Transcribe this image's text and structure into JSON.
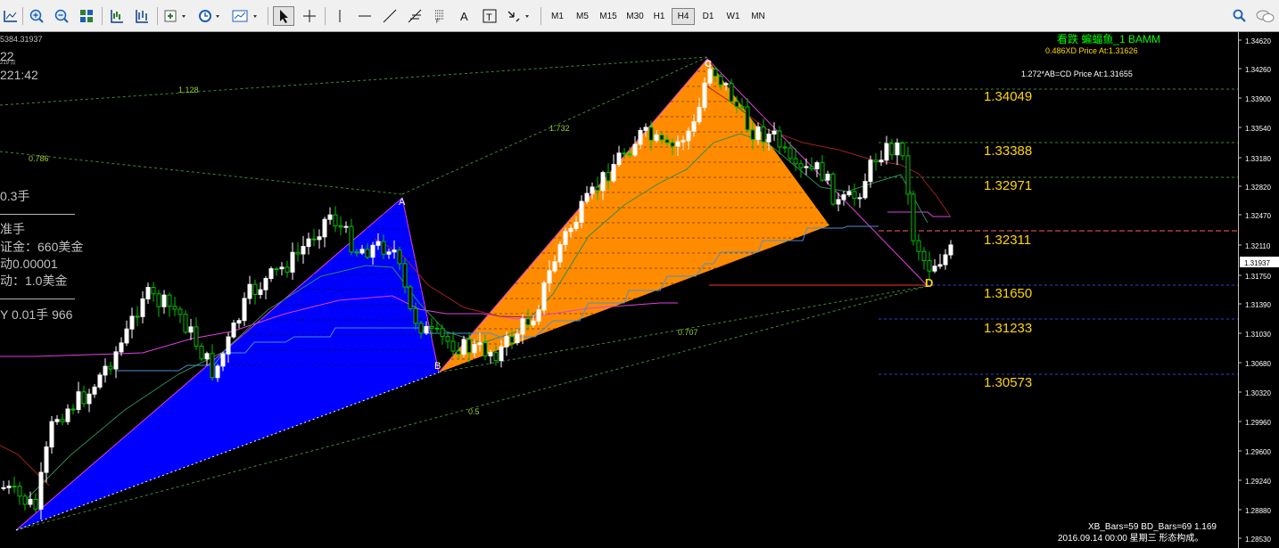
{
  "toolbar": {
    "timeframes": [
      "M1",
      "M5",
      "M15",
      "M30",
      "H1",
      "H4",
      "D1",
      "W1",
      "MN"
    ],
    "active_timeframe": "H4",
    "icons": [
      "chart-props-icon",
      "zoom-in-icon",
      "zoom-out-icon",
      "tile-windows-icon",
      "autoscroll-icon",
      "chart-shift-icon",
      "indicators-icon",
      "period-clock-icon",
      "templates-icon",
      "cursor-icon",
      "crosshair-icon",
      "vertical-line-icon",
      "horizontal-line-icon",
      "trendline-icon",
      "fibonacci-icon",
      "text-icon",
      "text-label-icon",
      "arrows-icon",
      "search-icon",
      "chat-icon"
    ]
  },
  "top_left": {
    "symbol_line": "5384.31937",
    "line2": "22",
    "line3": "219 点",
    "line4": "221:42"
  },
  "info_panel": {
    "lot": "0.3手",
    "dashes1": "——————",
    "standard": "准手",
    "margin": "证金：660美金",
    "move": "动0.00001",
    "move_value": "动：1.0美金",
    "dashes2": "——————",
    "buy": "Y  0.01手  966"
  },
  "pattern": {
    "title": "看跌 蝙蝠鱼_1 BAMM",
    "xd_text": "0.486XD Price At:1.31626",
    "abcd_text": "1.272*AB=CD Price At:1.31655",
    "points": [
      "A",
      "B",
      "C",
      "D"
    ],
    "footer_bars": "XB_Bars=59 BD_Bars=69 1.169",
    "footer_time": "2016.09.14 00:00 星期三 形态构成。"
  },
  "fib_ratios": [
    "1.128",
    "0.786",
    "1.732",
    "0.707",
    "0.5"
  ],
  "levels": [
    "1.34049",
    "1.33388",
    "1.32971",
    "1.32311",
    "1.31650",
    "1.31233",
    "1.30573"
  ],
  "current_price": "1.31937",
  "price_axis": [
    "1.34620",
    "1.34260",
    "1.33900",
    "1.33540",
    "1.33180",
    "1.32820",
    "1.32470",
    "1.32110",
    "1.31750",
    "1.31390",
    "1.31030",
    "1.30680",
    "1.30320",
    "1.29960",
    "1.29600",
    "1.29240",
    "1.28880",
    "1.28530"
  ],
  "colors": {
    "blue": "#0000ff",
    "orange": "#ff8c00",
    "bull": "#ffffff",
    "bear": "#00c000",
    "level_text": "#ffd700",
    "green_text": "#00ff00"
  }
}
